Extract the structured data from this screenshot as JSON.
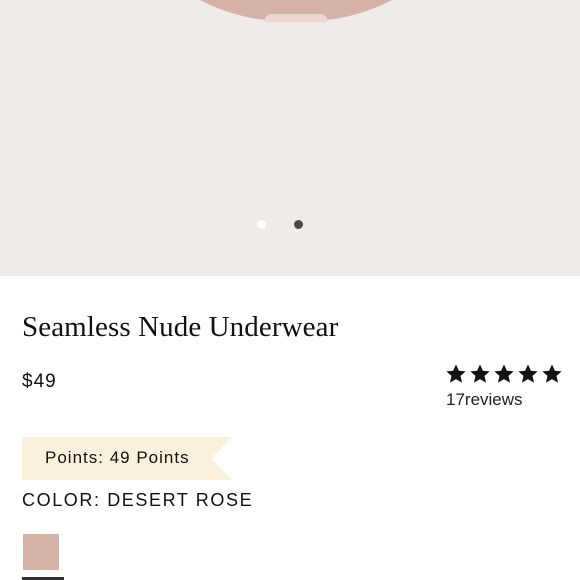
{
  "product": {
    "title": "Seamless Nude Underwear",
    "price": "$49",
    "rating": {
      "stars": 5,
      "max": 5,
      "reviews_label": "17reviews"
    },
    "points_label": "Points: 49 Points",
    "color_label": "COLOR: DESERT ROSE",
    "swatches": [
      {
        "name": "Desert Rose",
        "color": "#d4b3a6",
        "selected": true
      }
    ]
  },
  "gallery": {
    "images_count": 2,
    "active_index": 1,
    "background": "#efebe8",
    "product_color": "#d6b1a6"
  },
  "icons": {
    "star": "star-icon"
  }
}
